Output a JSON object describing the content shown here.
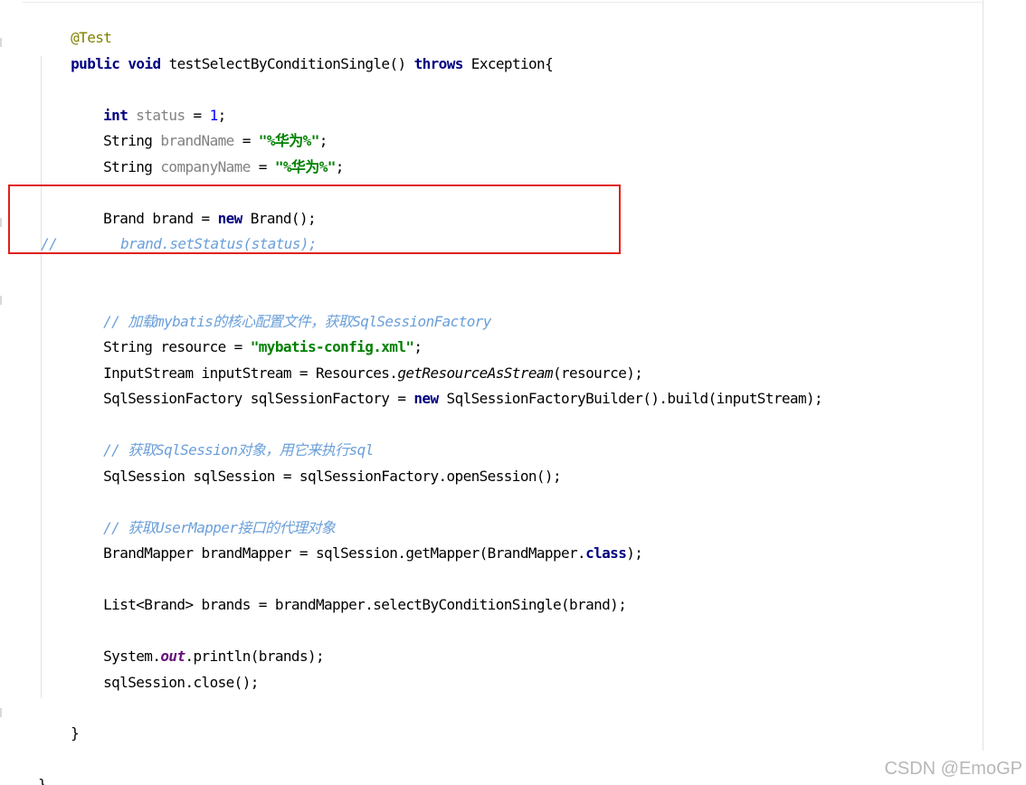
{
  "code": {
    "annotation": "@Test",
    "method_signature": {
      "kw_public": "public",
      "kw_void": "void",
      "name": " testSelectByConditionSingle() ",
      "kw_throws": "throws",
      "rest": " Exception{"
    },
    "status_line": {
      "kw": "int",
      "var": " status",
      "eq": " = ",
      "num": "1",
      "end": ";"
    },
    "brand_name_line": {
      "type": "String",
      "var": " brandName",
      "eq": " = ",
      "str": "\"%华为%\"",
      "end": ";"
    },
    "company_name_line": {
      "type": "String",
      "var": " companyName",
      "eq": " = ",
      "str": "\"%华为%\"",
      "end": ";"
    },
    "brand_new_line": {
      "pre": "Brand brand = ",
      "kw": "new",
      "post": " Brand();"
    },
    "commented_line": {
      "marker": "//",
      "text": "brand.setStatus(status);"
    },
    "comment_load": "// 加载mybatis的核心配置文件，获取SqlSessionFactory",
    "resource_line": {
      "pre": "String resource = ",
      "str": "\"mybatis-config.xml\"",
      "end": ";"
    },
    "input_stream_line": {
      "pre": "InputStream inputStream = Resources.",
      "call": "getResourceAsStream",
      "post": "(resource);"
    },
    "factory_line": {
      "pre": "SqlSessionFactory sqlSessionFactory = ",
      "kw": "new",
      "post": " SqlSessionFactoryBuilder().build(inputStream);"
    },
    "comment_session": "// 获取SqlSession对象，用它来执行sql",
    "session_line": "SqlSession sqlSession = sqlSessionFactory.openSession();",
    "comment_mapper": "// 获取UserMapper接口的代理对象",
    "mapper_line": {
      "pre": "BrandMapper brandMapper = sqlSession.getMapper(BrandMapper.",
      "kw": "class",
      "post": ");"
    },
    "list_line": "List<Brand> brands = brandMapper.selectByConditionSingle(brand);",
    "println_line": {
      "pre": "System.",
      "field": "out",
      "post": ".println(brands);"
    },
    "close_line": "sqlSession.close();",
    "method_close": "}",
    "class_close": "}"
  },
  "watermark": "CSDN @EmoGP",
  "colors": {
    "keyword": "#000080",
    "annotation": "#808000",
    "string": "#008000",
    "number": "#0000ff",
    "unused_variable": "#808080",
    "comment": "#6a9fd9",
    "static_field": "#660e7a",
    "highlight_box": "#e0201c",
    "watermark": "#b8b8b8"
  }
}
